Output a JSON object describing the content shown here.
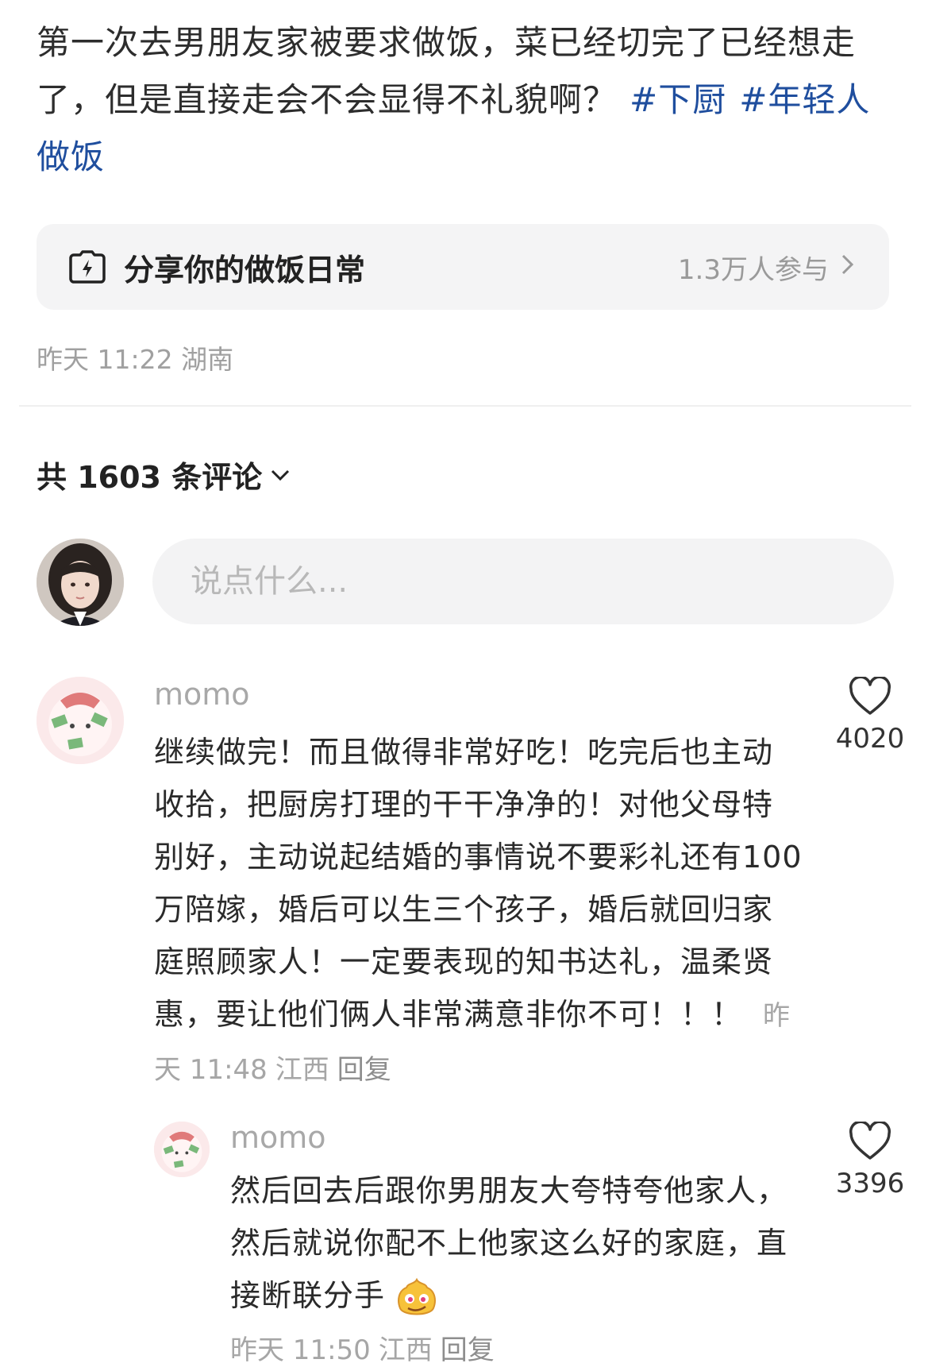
{
  "post": {
    "text": "第一次去男朋友家被要求做饭，菜已经切完了已经想走了，但是直接走会不会显得不礼貌啊？",
    "tags": [
      "#下厨",
      "#年轻人做饭"
    ]
  },
  "topic_card": {
    "icon": "camera-lightning-icon",
    "title": "分享你的做饭日常",
    "participants": "1.3万人参与",
    "chevron": "chevron-right-icon"
  },
  "post_meta": {
    "time": "昨天 11:22",
    "location": "湖南"
  },
  "comments_header": {
    "label": "共 1603 条评论"
  },
  "comment_input": {
    "placeholder": "说点什么..."
  },
  "comments": [
    {
      "username": "momo",
      "text": "继续做完！而且做得非常好吃！吃完后也主动收拾，把厨房打理的干干净净的！对他父母特别好，主动说起结婚的事情说不要彩礼还有100万陪嫁，婚后可以生三个孩子，婚后就回归家庭照顾家人！一定要表现的知书达礼，温柔贤惠，要让他们俩人非常满意非你不可！！！",
      "time": "昨天 11:48",
      "location": "江西",
      "reply_label": "回复",
      "likes": "4020"
    },
    {
      "username": "momo",
      "text": "然后回去后跟你男朋友大夸特夸他家人，然后就说你配不上他家这么好的家庭，直接断联分手",
      "emoji": "smirk-emoji",
      "time": "昨天 11:50",
      "location": "江西",
      "reply_label": "回复",
      "likes": "3396"
    }
  ],
  "colors": {
    "tag": "#1f4e9e",
    "muted": "#a0a0a0",
    "card_bg": "#f4f4f5"
  }
}
